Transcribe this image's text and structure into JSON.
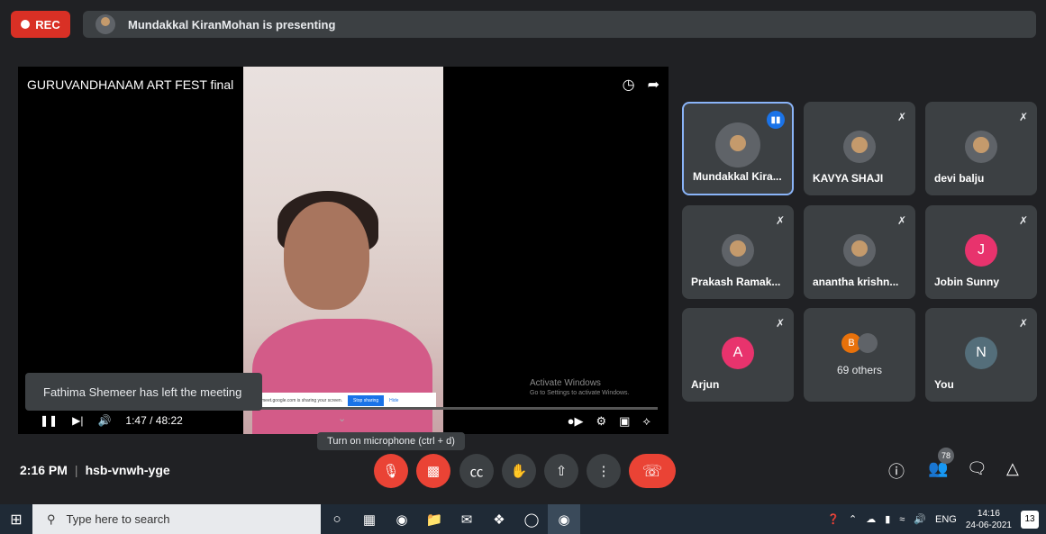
{
  "recording": {
    "label": "REC"
  },
  "banner": {
    "text": "Mundakkal KiranMohan is presenting"
  },
  "presentation": {
    "video_title": "GURUVANDHANAM ART FEST final",
    "time_display": "1:47 / 48:22",
    "progress_fraction": 0.037,
    "share_notice": "meet.google.com is sharing your screen.",
    "stop_sharing": "Stop sharing",
    "hide": "Hide",
    "watermark_title": "Activate Windows",
    "watermark_sub": "Go to Settings to activate Windows."
  },
  "toast": {
    "text": "Fathima Shemeer has left the meeting"
  },
  "tooltip": {
    "text": "Turn on microphone (ctrl + d)"
  },
  "participants": [
    {
      "name": "Mundakkal Kira...",
      "avatar": "photo",
      "speaking": true
    },
    {
      "name": "KAVYA SHAJI",
      "avatar": "photo",
      "muted": true
    },
    {
      "name": "devi balju",
      "avatar": "photo",
      "muted": true
    },
    {
      "name": "Prakash Ramak...",
      "avatar": "photo",
      "muted": true
    },
    {
      "name": "anantha krishn...",
      "avatar": "photo",
      "muted": true
    },
    {
      "name": "Jobin Sunny",
      "avatar_letter": "J",
      "muted": true
    },
    {
      "name": "Arjun",
      "avatar_letter": "A",
      "muted": true
    },
    {
      "name": "69 others",
      "avatar_letter": "B"
    },
    {
      "name": "You",
      "avatar_letter": "N",
      "muted": true
    }
  ],
  "meeting": {
    "time": "2:16 PM",
    "separator": "|",
    "code": "hsb-vnwh-yge",
    "participant_count": "78"
  },
  "taskbar": {
    "search_placeholder": "Type here to search",
    "language": "ENG",
    "time": "14:16",
    "date": "24-06-2021",
    "notifications": "13"
  },
  "colors": {
    "record_red": "#d93025",
    "accent_blue": "#1a73e8",
    "background": "#202124",
    "tile": "#3c4043"
  }
}
